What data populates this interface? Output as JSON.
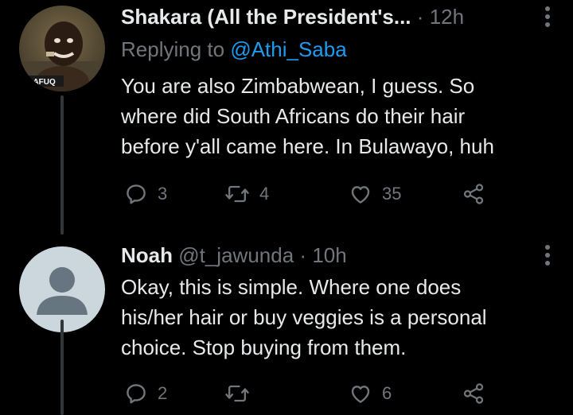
{
  "tweets": [
    {
      "author_name": "Shakara (All the President's...",
      "handle": "",
      "separator": "·",
      "time": "12h",
      "reply_prefix": "Replying to ",
      "reply_to": "@Athi_Saba",
      "avatar_badge": "DAFUQ",
      "lines": [
        "You are also Zimbabwean,  I guess.  So",
        "where did South Africans do their hair",
        "before y'all came here. In Bulawayo, huh"
      ],
      "counts": {
        "replies": "3",
        "retweets": "4",
        "likes": "35"
      }
    },
    {
      "author_name": "Noah",
      "handle": "@t_jawunda",
      "separator": "·",
      "time": "10h",
      "lines": [
        "Okay, this is simple. Where one does",
        "his/her hair  or buy veggies is a personal",
        "choice. Stop buying from them."
      ],
      "counts": {
        "replies": "2",
        "retweets": "",
        "likes": "6"
      }
    }
  ],
  "icons": {
    "reply": "reply-icon",
    "retweet": "retweet-icon",
    "like": "heart-icon",
    "share": "share-icon",
    "menu": "more-vertical-icon"
  },
  "colors": {
    "background": "#000000",
    "text": "#e7e9ea",
    "muted": "#71767b",
    "accent": "#1d9bf0",
    "thread_line": "#333639"
  }
}
